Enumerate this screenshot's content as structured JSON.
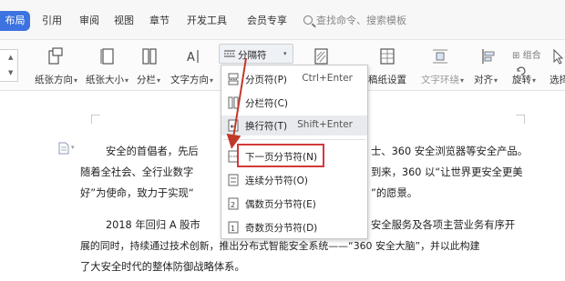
{
  "ribbon": {
    "active_tab": "布局",
    "tabs": [
      "引用",
      "审阅",
      "视图",
      "章节",
      "开发工具",
      "会员专享"
    ],
    "search_placeholder": "查找命令、搜索模板"
  },
  "toolbar": {
    "margin_direction": "纸张方向",
    "paper_size": "纸张大小",
    "columns": "分栏",
    "text_direction": "文字方向",
    "separator_button": "分隔符",
    "paper_setting": "稿纸设置",
    "text_wrap": "文字环绕",
    "align": "对齐",
    "rotate": "旋转",
    "select": "选择",
    "combine": "组合"
  },
  "separator_menu": {
    "items": [
      {
        "label": "分页符(P)",
        "shortcut": "Ctrl+Enter"
      },
      {
        "label": "分栏符(C)",
        "shortcut": ""
      },
      {
        "label": "换行符(T)",
        "shortcut": "Shift+Enter"
      },
      {
        "label": "下一页分节符(N)",
        "shortcut": ""
      },
      {
        "label": "连续分节符(O)",
        "shortcut": ""
      },
      {
        "label": "偶数页分节符(E)",
        "shortcut": ""
      },
      {
        "label": "奇数页分节符(D)",
        "shortcut": ""
      }
    ],
    "highlighted_index": 3,
    "hover_index": 2
  },
  "document": {
    "p1": {
      "line1_left": "安全的首倡者，先后",
      "line1_right": "士、360 安全浏览器等安全产品。",
      "line2_left": "随着全社会、全行业数字",
      "line2_right": "到来，360 以“让世界更安全更美",
      "line3_left": "好”为使命，致力于实现“",
      "line3_right": "”的愿景。"
    },
    "p2": {
      "line1_left": "2018 年回归 A 股市",
      "line1_right": "安全服务及各项主营业务有序开",
      "line2": "展的同时，持续通过技术创新，推出分布式智能安全系统——“360 安全大脑”，并以此构建",
      "line3": "了大安全时代的整体防御战略体系。"
    }
  },
  "colors": {
    "accent": "#3d73e0",
    "highlight_border": "#d23a3a",
    "arrow": "#c0392b"
  }
}
